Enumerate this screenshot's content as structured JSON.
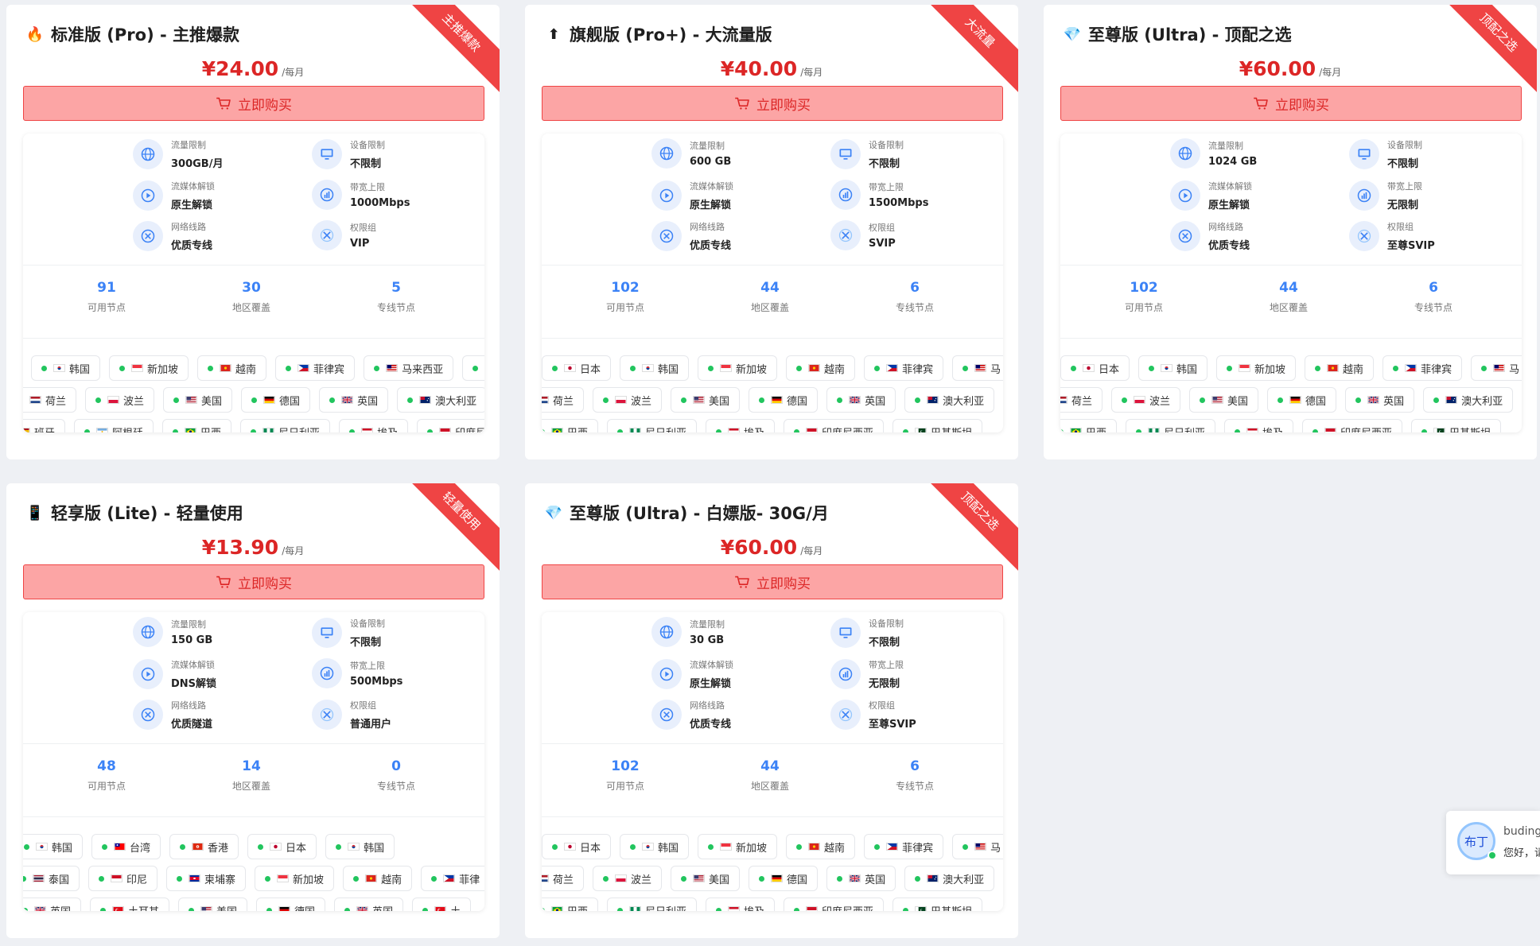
{
  "cards": [
    {
      "title": "标准版 (Pro) - 主推爆款",
      "emoji": "🔥",
      "ribbon": "主推爆款",
      "price": "¥24.00",
      "unit": "/每月",
      "buy_label": "立即购买",
      "specs": [
        {
          "label": "流量限制",
          "value": "300GB/月",
          "icon": "globe-icon"
        },
        {
          "label": "设备限制",
          "value": "不限制",
          "icon": "monitor-icon"
        },
        {
          "label": "流媒体解锁",
          "value": "原生解锁",
          "icon": "play-icon"
        },
        {
          "label": "带宽上限",
          "value": "1000Mbps",
          "icon": "speed-icon"
        },
        {
          "label": "网络线路",
          "value": "优质专线",
          "icon": "route-icon"
        },
        {
          "label": "权限组",
          "value": "VIP",
          "icon": "tools-icon"
        }
      ],
      "stats": [
        {
          "num": "91",
          "label": "可用节点"
        },
        {
          "num": "30",
          "label": "地区覆盖"
        },
        {
          "num": "5",
          "label": "专线节点"
        }
      ],
      "rows": [
        [
          {
            "name": "韩国",
            "flag": "kr"
          },
          {
            "name": "新加坡",
            "flag": "sg"
          },
          {
            "name": "越南",
            "flag": "vn"
          },
          {
            "name": "菲律宾",
            "flag": "ph"
          },
          {
            "name": "马来西亚",
            "flag": "my"
          },
          {
            "name": "",
            "flag": "none"
          }
        ],
        [
          {
            "name": "荷兰",
            "flag": "nl"
          },
          {
            "name": "波兰",
            "flag": "pl"
          },
          {
            "name": "美国",
            "flag": "us"
          },
          {
            "name": "德国",
            "flag": "de"
          },
          {
            "name": "英国",
            "flag": "gb"
          },
          {
            "name": "澳大利亚",
            "flag": "au"
          }
        ],
        [
          {
            "name": "班牙",
            "flag": "es"
          },
          {
            "name": "阿根廷",
            "flag": "ar"
          },
          {
            "name": "巴西",
            "flag": "br"
          },
          {
            "name": "尼日利亚",
            "flag": "ng"
          },
          {
            "name": "埃及",
            "flag": "eg"
          },
          {
            "name": "印度尼西",
            "flag": "id"
          }
        ]
      ]
    },
    {
      "title": "旗舰版 (Pro+) - 大流量版",
      "emoji": "⬆",
      "ribbon": "大流量",
      "price": "¥40.00",
      "unit": "/每月",
      "buy_label": "立即购买",
      "specs": [
        {
          "label": "流量限制",
          "value": "600 GB",
          "icon": "globe-icon"
        },
        {
          "label": "设备限制",
          "value": "不限制",
          "icon": "monitor-icon"
        },
        {
          "label": "流媒体解锁",
          "value": "原生解锁",
          "icon": "play-icon"
        },
        {
          "label": "带宽上限",
          "value": "1500Mbps",
          "icon": "speed-icon"
        },
        {
          "label": "网络线路",
          "value": "优质专线",
          "icon": "route-icon"
        },
        {
          "label": "权限组",
          "value": "SVIP",
          "icon": "tools-icon"
        }
      ],
      "stats": [
        {
          "num": "102",
          "label": "可用节点"
        },
        {
          "num": "44",
          "label": "地区覆盖"
        },
        {
          "num": "6",
          "label": "专线节点"
        }
      ],
      "rows": [
        [
          {
            "name": "日本",
            "flag": "jp"
          },
          {
            "name": "韩国",
            "flag": "kr"
          },
          {
            "name": "新加坡",
            "flag": "sg"
          },
          {
            "name": "越南",
            "flag": "vn"
          },
          {
            "name": "菲律宾",
            "flag": "ph"
          },
          {
            "name": "马",
            "flag": "my"
          }
        ],
        [
          {
            "name": "荷兰",
            "flag": "nl"
          },
          {
            "name": "波兰",
            "flag": "pl"
          },
          {
            "name": "美国",
            "flag": "us"
          },
          {
            "name": "德国",
            "flag": "de"
          },
          {
            "name": "英国",
            "flag": "gb"
          },
          {
            "name": "澳大利亚",
            "flag": "au"
          }
        ],
        [
          {
            "name": "巴西",
            "flag": "br"
          },
          {
            "name": "尼日利亚",
            "flag": "ng"
          },
          {
            "name": "埃及",
            "flag": "eg"
          },
          {
            "name": "印度尼西亚",
            "flag": "id"
          },
          {
            "name": "巴基斯坦",
            "flag": "pk"
          }
        ]
      ]
    },
    {
      "title": "至尊版 (Ultra) - 顶配之选",
      "emoji": "💎",
      "ribbon": "顶配之选",
      "price": "¥60.00",
      "unit": "/每月",
      "buy_label": "立即购买",
      "specs": [
        {
          "label": "流量限制",
          "value": "1024 GB",
          "icon": "globe-icon"
        },
        {
          "label": "设备限制",
          "value": "不限制",
          "icon": "monitor-icon"
        },
        {
          "label": "流媒体解锁",
          "value": "原生解锁",
          "icon": "play-icon"
        },
        {
          "label": "带宽上限",
          "value": "无限制",
          "icon": "speed-icon"
        },
        {
          "label": "网络线路",
          "value": "优质专线",
          "icon": "route-icon"
        },
        {
          "label": "权限组",
          "value": "至尊SVIP",
          "icon": "tools-icon"
        }
      ],
      "stats": [
        {
          "num": "102",
          "label": "可用节点"
        },
        {
          "num": "44",
          "label": "地区覆盖"
        },
        {
          "num": "6",
          "label": "专线节点"
        }
      ],
      "rows": [
        [
          {
            "name": "日本",
            "flag": "jp"
          },
          {
            "name": "韩国",
            "flag": "kr"
          },
          {
            "name": "新加坡",
            "flag": "sg"
          },
          {
            "name": "越南",
            "flag": "vn"
          },
          {
            "name": "菲律宾",
            "flag": "ph"
          },
          {
            "name": "马",
            "flag": "my"
          }
        ],
        [
          {
            "name": "荷兰",
            "flag": "nl"
          },
          {
            "name": "波兰",
            "flag": "pl"
          },
          {
            "name": "美国",
            "flag": "us"
          },
          {
            "name": "德国",
            "flag": "de"
          },
          {
            "name": "英国",
            "flag": "gb"
          },
          {
            "name": "澳大利亚",
            "flag": "au"
          }
        ],
        [
          {
            "name": "巴西",
            "flag": "br"
          },
          {
            "name": "尼日利亚",
            "flag": "ng"
          },
          {
            "name": "埃及",
            "flag": "eg"
          },
          {
            "name": "印度尼西亚",
            "flag": "id"
          },
          {
            "name": "巴基斯坦",
            "flag": "pk"
          }
        ]
      ]
    },
    {
      "title": "轻享版 (Lite) - 轻量使用",
      "emoji": "📱",
      "ribbon": "轻量使用",
      "price": "¥13.90",
      "unit": "/每月",
      "buy_label": "立即购买",
      "specs": [
        {
          "label": "流量限制",
          "value": "150 GB",
          "icon": "globe-icon"
        },
        {
          "label": "设备限制",
          "value": "不限制",
          "icon": "monitor-icon"
        },
        {
          "label": "流媒体解锁",
          "value": "DNS解锁",
          "icon": "play-icon"
        },
        {
          "label": "带宽上限",
          "value": "500Mbps",
          "icon": "speed-icon"
        },
        {
          "label": "网络线路",
          "value": "优质隧道",
          "icon": "route-icon"
        },
        {
          "label": "权限组",
          "value": "普通用户",
          "icon": "tools-icon"
        }
      ],
      "stats": [
        {
          "num": "48",
          "label": "可用节点"
        },
        {
          "num": "14",
          "label": "地区覆盖"
        },
        {
          "num": "0",
          "label": "专线节点"
        }
      ],
      "rows": [
        [
          {
            "name": "韩国",
            "flag": "kr"
          },
          {
            "name": "台湾",
            "flag": "tw"
          },
          {
            "name": "香港",
            "flag": "hk"
          },
          {
            "name": "日本",
            "flag": "jp"
          },
          {
            "name": "韩国",
            "flag": "kr"
          }
        ],
        [
          {
            "name": "泰国",
            "flag": "th"
          },
          {
            "name": "印尼",
            "flag": "id"
          },
          {
            "name": "柬埔寨",
            "flag": "kh"
          },
          {
            "name": "新加坡",
            "flag": "sg"
          },
          {
            "name": "越南",
            "flag": "vn"
          },
          {
            "name": "菲律",
            "flag": "ph"
          }
        ],
        [
          {
            "name": "英国",
            "flag": "gb"
          },
          {
            "name": "土耳其",
            "flag": "tr"
          },
          {
            "name": "美国",
            "flag": "us"
          },
          {
            "name": "德国",
            "flag": "de"
          },
          {
            "name": "英国",
            "flag": "gb"
          },
          {
            "name": "土",
            "flag": "tr"
          }
        ]
      ]
    },
    {
      "title": "至尊版 (Ultra) - 白嫖版- 30G/月",
      "emoji": "💎",
      "ribbon": "顶配之选",
      "price": "¥60.00",
      "unit": "/每月",
      "buy_label": "立即购买",
      "specs": [
        {
          "label": "流量限制",
          "value": "30 GB",
          "icon": "globe-icon"
        },
        {
          "label": "设备限制",
          "value": "不限制",
          "icon": "monitor-icon"
        },
        {
          "label": "流媒体解锁",
          "value": "原生解锁",
          "icon": "play-icon"
        },
        {
          "label": "带宽上限",
          "value": "无限制",
          "icon": "speed-icon"
        },
        {
          "label": "网络线路",
          "value": "优质专线",
          "icon": "route-icon"
        },
        {
          "label": "权限组",
          "value": "至尊SVIP",
          "icon": "tools-icon"
        }
      ],
      "stats": [
        {
          "num": "102",
          "label": "可用节点"
        },
        {
          "num": "44",
          "label": "地区覆盖"
        },
        {
          "num": "6",
          "label": "专线节点"
        }
      ],
      "rows": [
        [
          {
            "name": "日本",
            "flag": "jp"
          },
          {
            "name": "韩国",
            "flag": "kr"
          },
          {
            "name": "新加坡",
            "flag": "sg"
          },
          {
            "name": "越南",
            "flag": "vn"
          },
          {
            "name": "菲律宾",
            "flag": "ph"
          },
          {
            "name": "马",
            "flag": "my"
          }
        ],
        [
          {
            "name": "荷兰",
            "flag": "nl"
          },
          {
            "name": "波兰",
            "flag": "pl"
          },
          {
            "name": "美国",
            "flag": "us"
          },
          {
            "name": "德国",
            "flag": "de"
          },
          {
            "name": "英国",
            "flag": "gb"
          },
          {
            "name": "澳大利亚",
            "flag": "au"
          }
        ],
        [
          {
            "name": "巴西",
            "flag": "br"
          },
          {
            "name": "尼日利亚",
            "flag": "ng"
          },
          {
            "name": "埃及",
            "flag": "eg"
          },
          {
            "name": "印度尼西亚",
            "flag": "id"
          },
          {
            "name": "巴基斯坦",
            "flag": "pk"
          }
        ]
      ]
    }
  ],
  "chat": {
    "name": "buding",
    "message": "您好，请",
    "avatar_text": "布丁"
  },
  "colors": {
    "accent": "#3b82f6",
    "price": "#dc2626",
    "button_bg": "#fca5a5",
    "ribbon": "#ef4444",
    "online": "#22c55e"
  }
}
